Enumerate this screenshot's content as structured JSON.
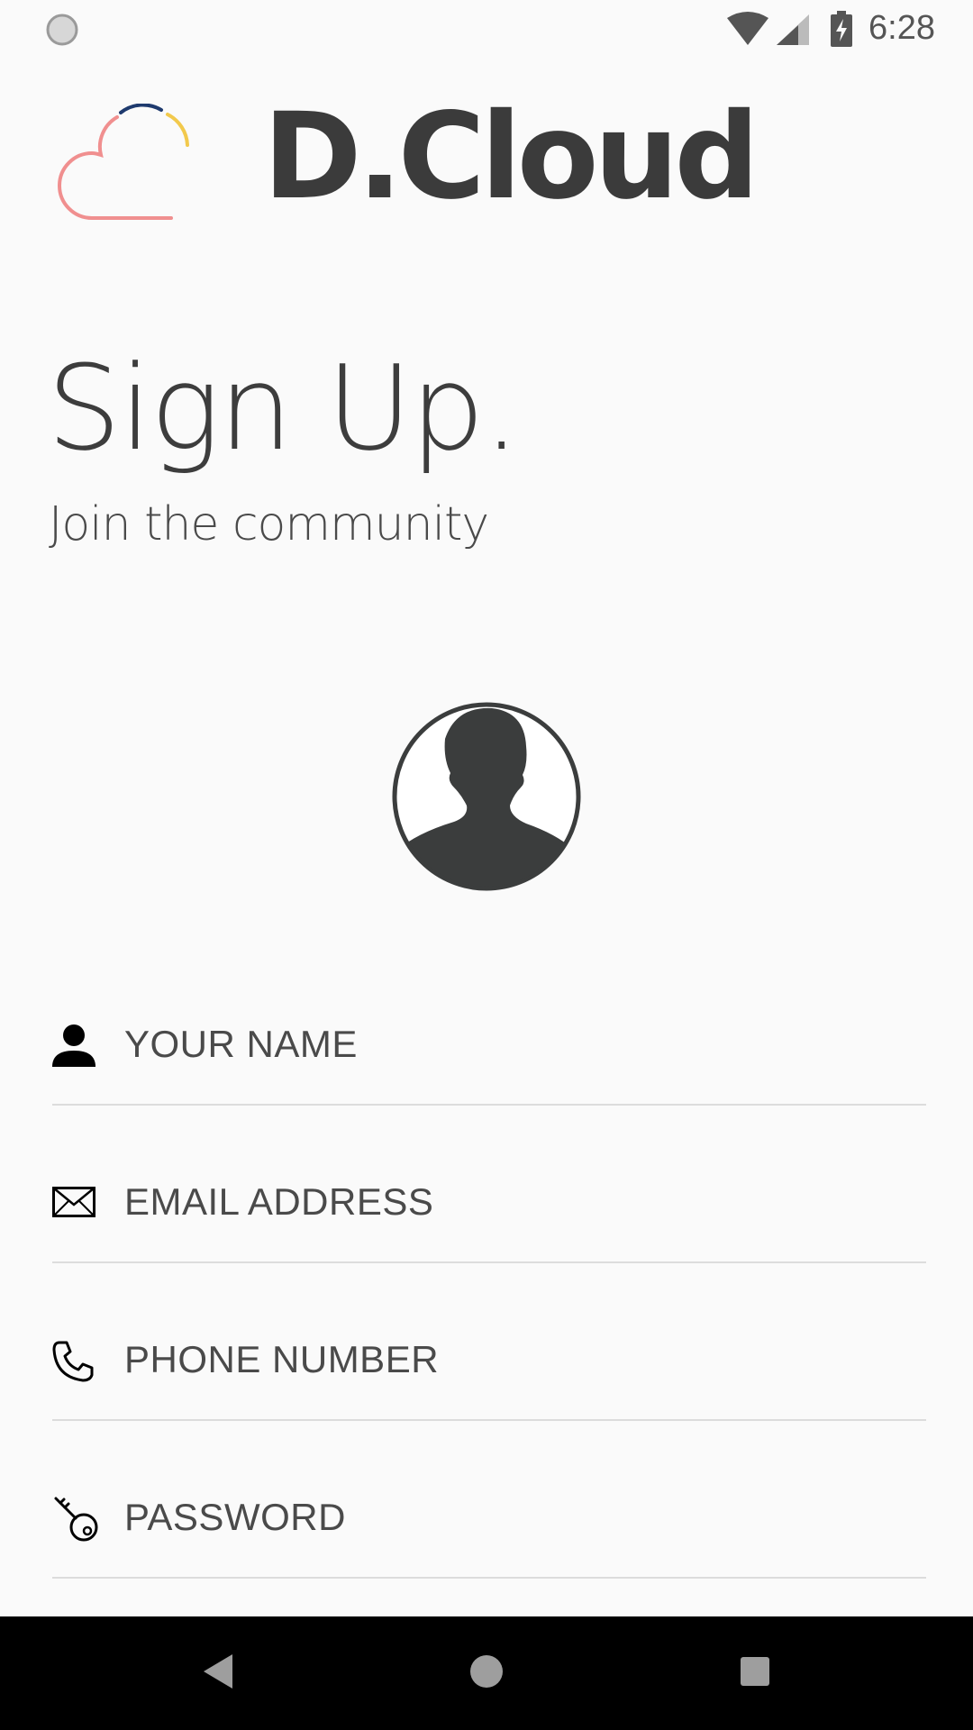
{
  "status_bar": {
    "time": "6:28",
    "icons": [
      "sync-icon",
      "wifi-icon",
      "cellular-signal-icon",
      "battery-charging-icon"
    ]
  },
  "brand": {
    "name": "D.Cloud",
    "logo_icon": "cloud-icon",
    "colors": {
      "cloud_outline": "#f08f8f",
      "arc_navy": "#1e3a6e",
      "arc_yellow": "#f2c94c"
    }
  },
  "header": {
    "title": "Sign Up.",
    "subtitle": "Join the community"
  },
  "avatar": {
    "icon": "user-silhouette-icon"
  },
  "form": {
    "name": {
      "placeholder": "YOUR NAME",
      "value": "",
      "icon": "person-icon"
    },
    "email": {
      "placeholder": "EMAIL ADDRESS",
      "value": "",
      "icon": "envelope-icon"
    },
    "phone": {
      "placeholder": "PHONE NUMBER",
      "value": "",
      "icon": "phone-icon"
    },
    "password": {
      "placeholder": "PASSWORD",
      "value": "",
      "icon": "key-icon"
    }
  },
  "nav_bar": {
    "buttons": [
      "back-icon",
      "home-icon",
      "recents-icon"
    ]
  },
  "theme": {
    "text": "#3d3d3d",
    "background": "#fafafa",
    "divider": "#dcdcdc"
  }
}
